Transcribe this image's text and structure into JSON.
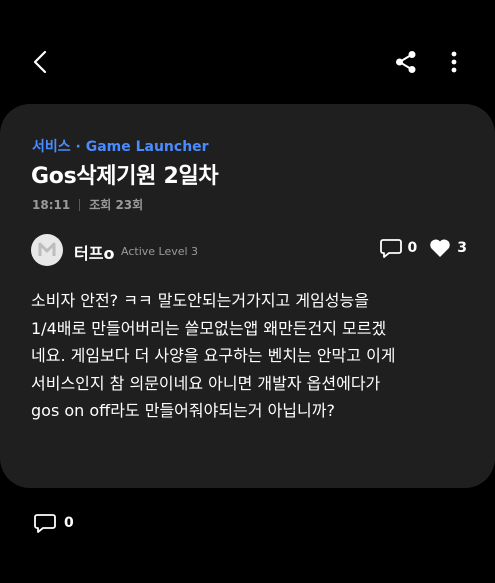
{
  "category": "서비스 · Game Launcher",
  "post": {
    "title": "Gos삭제기원 2일차",
    "time": "18:11",
    "views": "조회 23회",
    "author": {
      "name": "터프o",
      "level": "Active Level 3"
    },
    "comment_count": "0",
    "like_count": "3",
    "body": "소비자 안전? ㅋㅋ 말도안되는거가지고 게임성능을\n1/4배로 만들어버리는 쓸모없는앱 왜만든건지 모르겠\n네요. 게임보다 더 사양을 요구하는 벤치는 안막고 이게\n서비스인지 참 의문이네요 아니면 개발자 옵션에다가\ngos on off라도 만들어줘야되는거 아닙니까?"
  },
  "footer": {
    "comment_count": "0"
  },
  "colors": {
    "background": "#000000",
    "card": "#1f1f1f",
    "accent": "#4a8cff",
    "muted": "#9a9a9a"
  }
}
